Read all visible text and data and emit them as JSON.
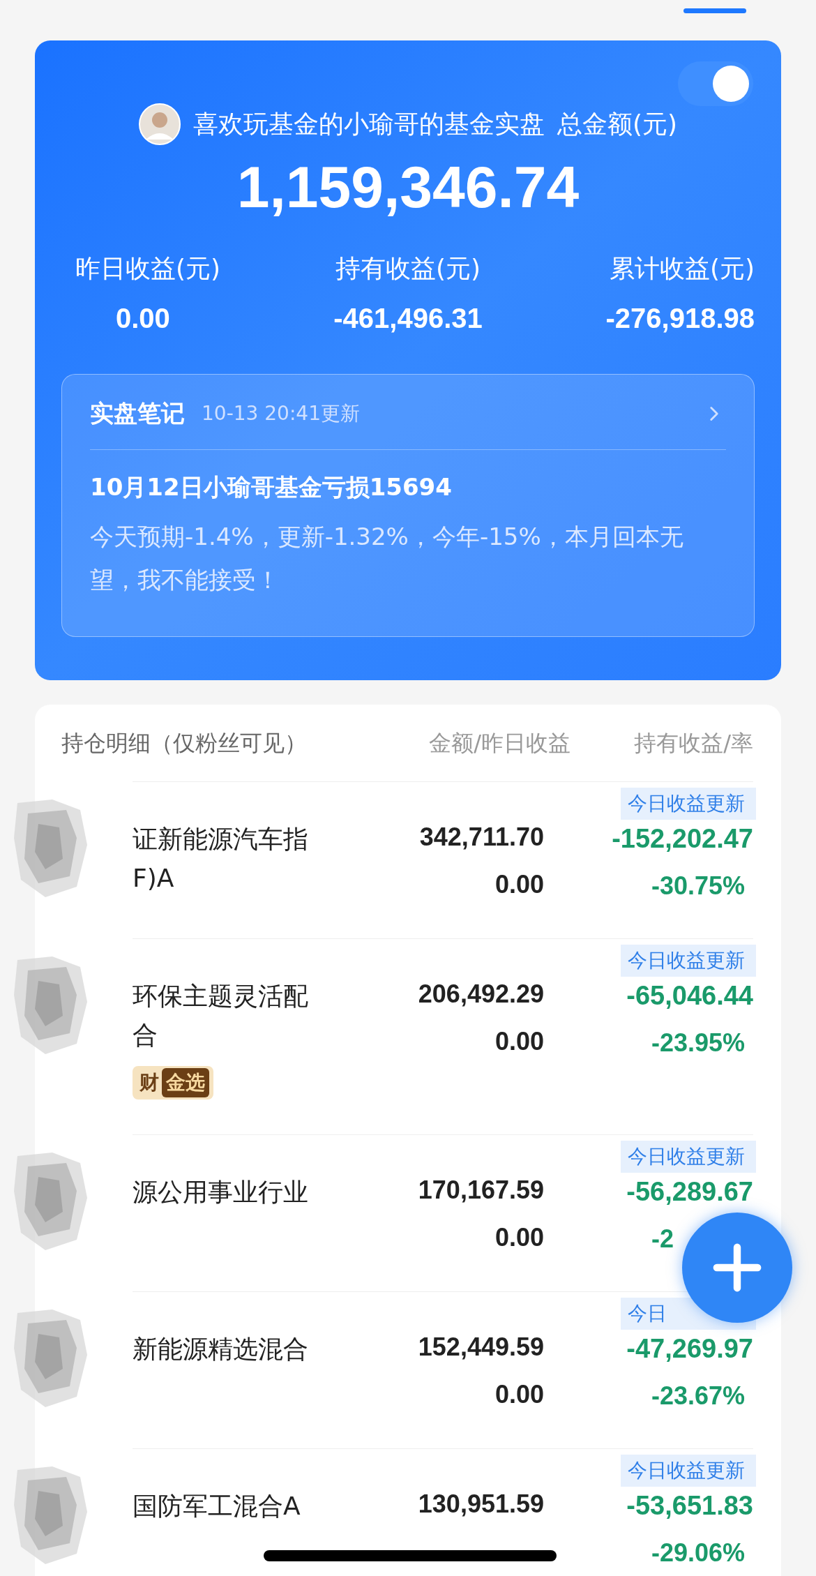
{
  "profile": {
    "title": "喜欢玩基金的小瑜哥的基金实盘",
    "total_label": "总金额(元)",
    "total": "1,159,346.74",
    "privacy_toggle": {
      "on": true
    }
  },
  "stats": [
    {
      "label": "昨日收益(元)",
      "value": "0.00"
    },
    {
      "label": "持有收益(元)",
      "value": "-461,496.31"
    },
    {
      "label": "累计收益(元)",
      "value": "-276,918.98"
    }
  ],
  "note": {
    "title": "实盘笔记",
    "updated": "10-13 20:41更新",
    "headline": "10月12日小瑜哥基金亏损15694",
    "body": "今天预期-1.4%，更新-1.32%，今年-15%，本月回本无望，我不能接受！"
  },
  "holdings": {
    "columns": [
      "持仓明细（仅粉丝可见）",
      "金额/昨日收益",
      "持有收益/率"
    ],
    "rows": [
      {
        "name": "证新能源汽车指F)A",
        "amount": "342,711.70",
        "daily_income": "0.00",
        "tag": "今日收益更新",
        "holding_income": "-152,202.47",
        "holding_rate": "-30.75%"
      },
      {
        "name": "环保主题灵活配合",
        "amount": "206,492.29",
        "daily_income": "0.00",
        "tag": "今日收益更新",
        "holding_income": "-65,046.44",
        "holding_rate": "-23.95%",
        "badges": [
          {
            "kind": "plain",
            "text": "财"
          },
          {
            "kind": "dark",
            "text": "金选"
          }
        ]
      },
      {
        "name": "源公用事业行业",
        "amount": "170,167.59",
        "daily_income": "0.00",
        "tag": "今日收益更新",
        "holding_income": "-56,289.67",
        "holding_rate": "-2"
      },
      {
        "name": "新能源精选混合",
        "amount": "152,449.59",
        "daily_income": "0.00",
        "tag": "今日",
        "holding_income": "-47,269.97",
        "holding_rate": "-23.67%"
      },
      {
        "name": "国防军工混合A",
        "amount": "130,951.59",
        "tag": "今日收益更新",
        "holding_income": "-53,651.83",
        "holding_rate": "-29.06%"
      }
    ]
  }
}
